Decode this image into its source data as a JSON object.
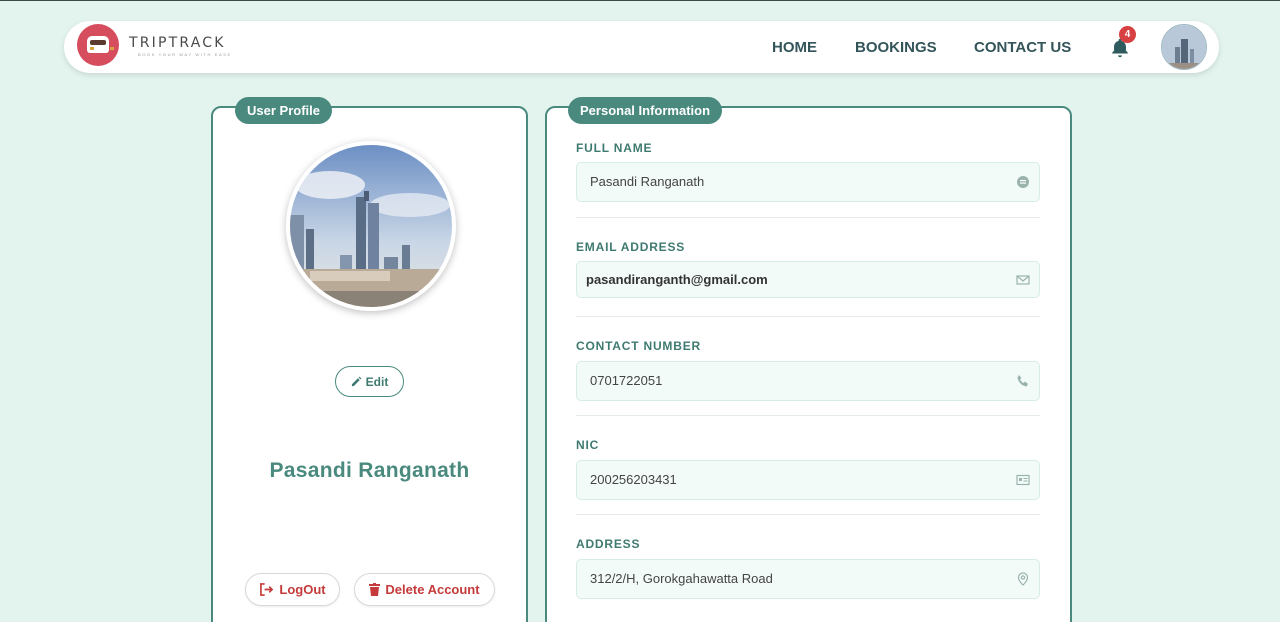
{
  "brand": {
    "name": "TRIPTRACK",
    "tagline": "BOOK YOUR WAY WITH EASE"
  },
  "nav": {
    "home": "HOME",
    "bookings": "BOOKINGS",
    "contact": "CONTACT US",
    "notification_count": "4"
  },
  "profile": {
    "tab_label": "User Profile",
    "edit_label": "Edit",
    "name": "Pasandi Ranganath",
    "logout_label": "LogOut",
    "delete_label": "Delete Account"
  },
  "personal": {
    "tab_label": "Personal Information",
    "fields": [
      {
        "label": "FULL NAME",
        "value": "Pasandi Ranganath",
        "icon": "id-badge-icon"
      },
      {
        "label": "EMAIL ADDRESS",
        "value": "pasandiranganth@gmail.com",
        "icon": "envelope-icon"
      },
      {
        "label": "CONTACT NUMBER",
        "value": "0701722051",
        "icon": "phone-icon"
      },
      {
        "label": "NIC",
        "value": "200256203431",
        "icon": "id-card-icon"
      },
      {
        "label": "ADDRESS",
        "value": "312/2/H, Gorokgahawatta Road",
        "icon": "location-pin-icon"
      }
    ]
  },
  "colors": {
    "background": "#e3f4ee",
    "accent": "#4a8a7e",
    "danger": "#c53a3a",
    "brand_red": "#d64d5d"
  }
}
